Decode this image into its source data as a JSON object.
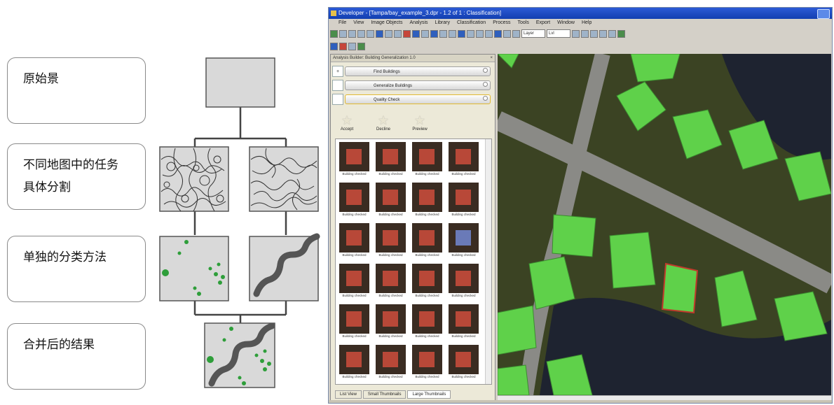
{
  "stages": [
    {
      "label": "原始景"
    },
    {
      "label": "不同地图中的任务\n具体分割"
    },
    {
      "label": "单独的分类方法"
    },
    {
      "label": "合并后的结果"
    }
  ],
  "colors": {
    "tile_fill": "#d9d9d9",
    "tile_border": "#555555",
    "connector": "#444444",
    "dot_green": "#2e9e3a",
    "river": "#555555",
    "building_green": "#5fd14a",
    "road": "#8a8a86",
    "water": "#1e2330"
  },
  "app": {
    "title": "Developer - [Tampa/bay_example_3.dpr - 1.2 of 1 : Classification]",
    "menus": [
      "File",
      "View",
      "Image Objects",
      "Analysis",
      "Library",
      "Classification",
      "Process",
      "Tools",
      "Export",
      "Window",
      "Help"
    ],
    "toolbar_select1": "Layer",
    "toolbar_select2": "Lvl",
    "panel_title": "Analysis Builder: Building Generalization 1.0",
    "steps": [
      {
        "num": "+",
        "label": "Find Buildings"
      },
      {
        "num": "",
        "label": "Generalize Buildings"
      },
      {
        "num": "",
        "label": "Quality Check"
      }
    ],
    "actions": [
      "Accept",
      "Decline",
      "Preview"
    ],
    "thumbnail_caption": "Building checked",
    "tabs": [
      "List View",
      "Small Thumbnails",
      "Large Thumbnails"
    ]
  }
}
